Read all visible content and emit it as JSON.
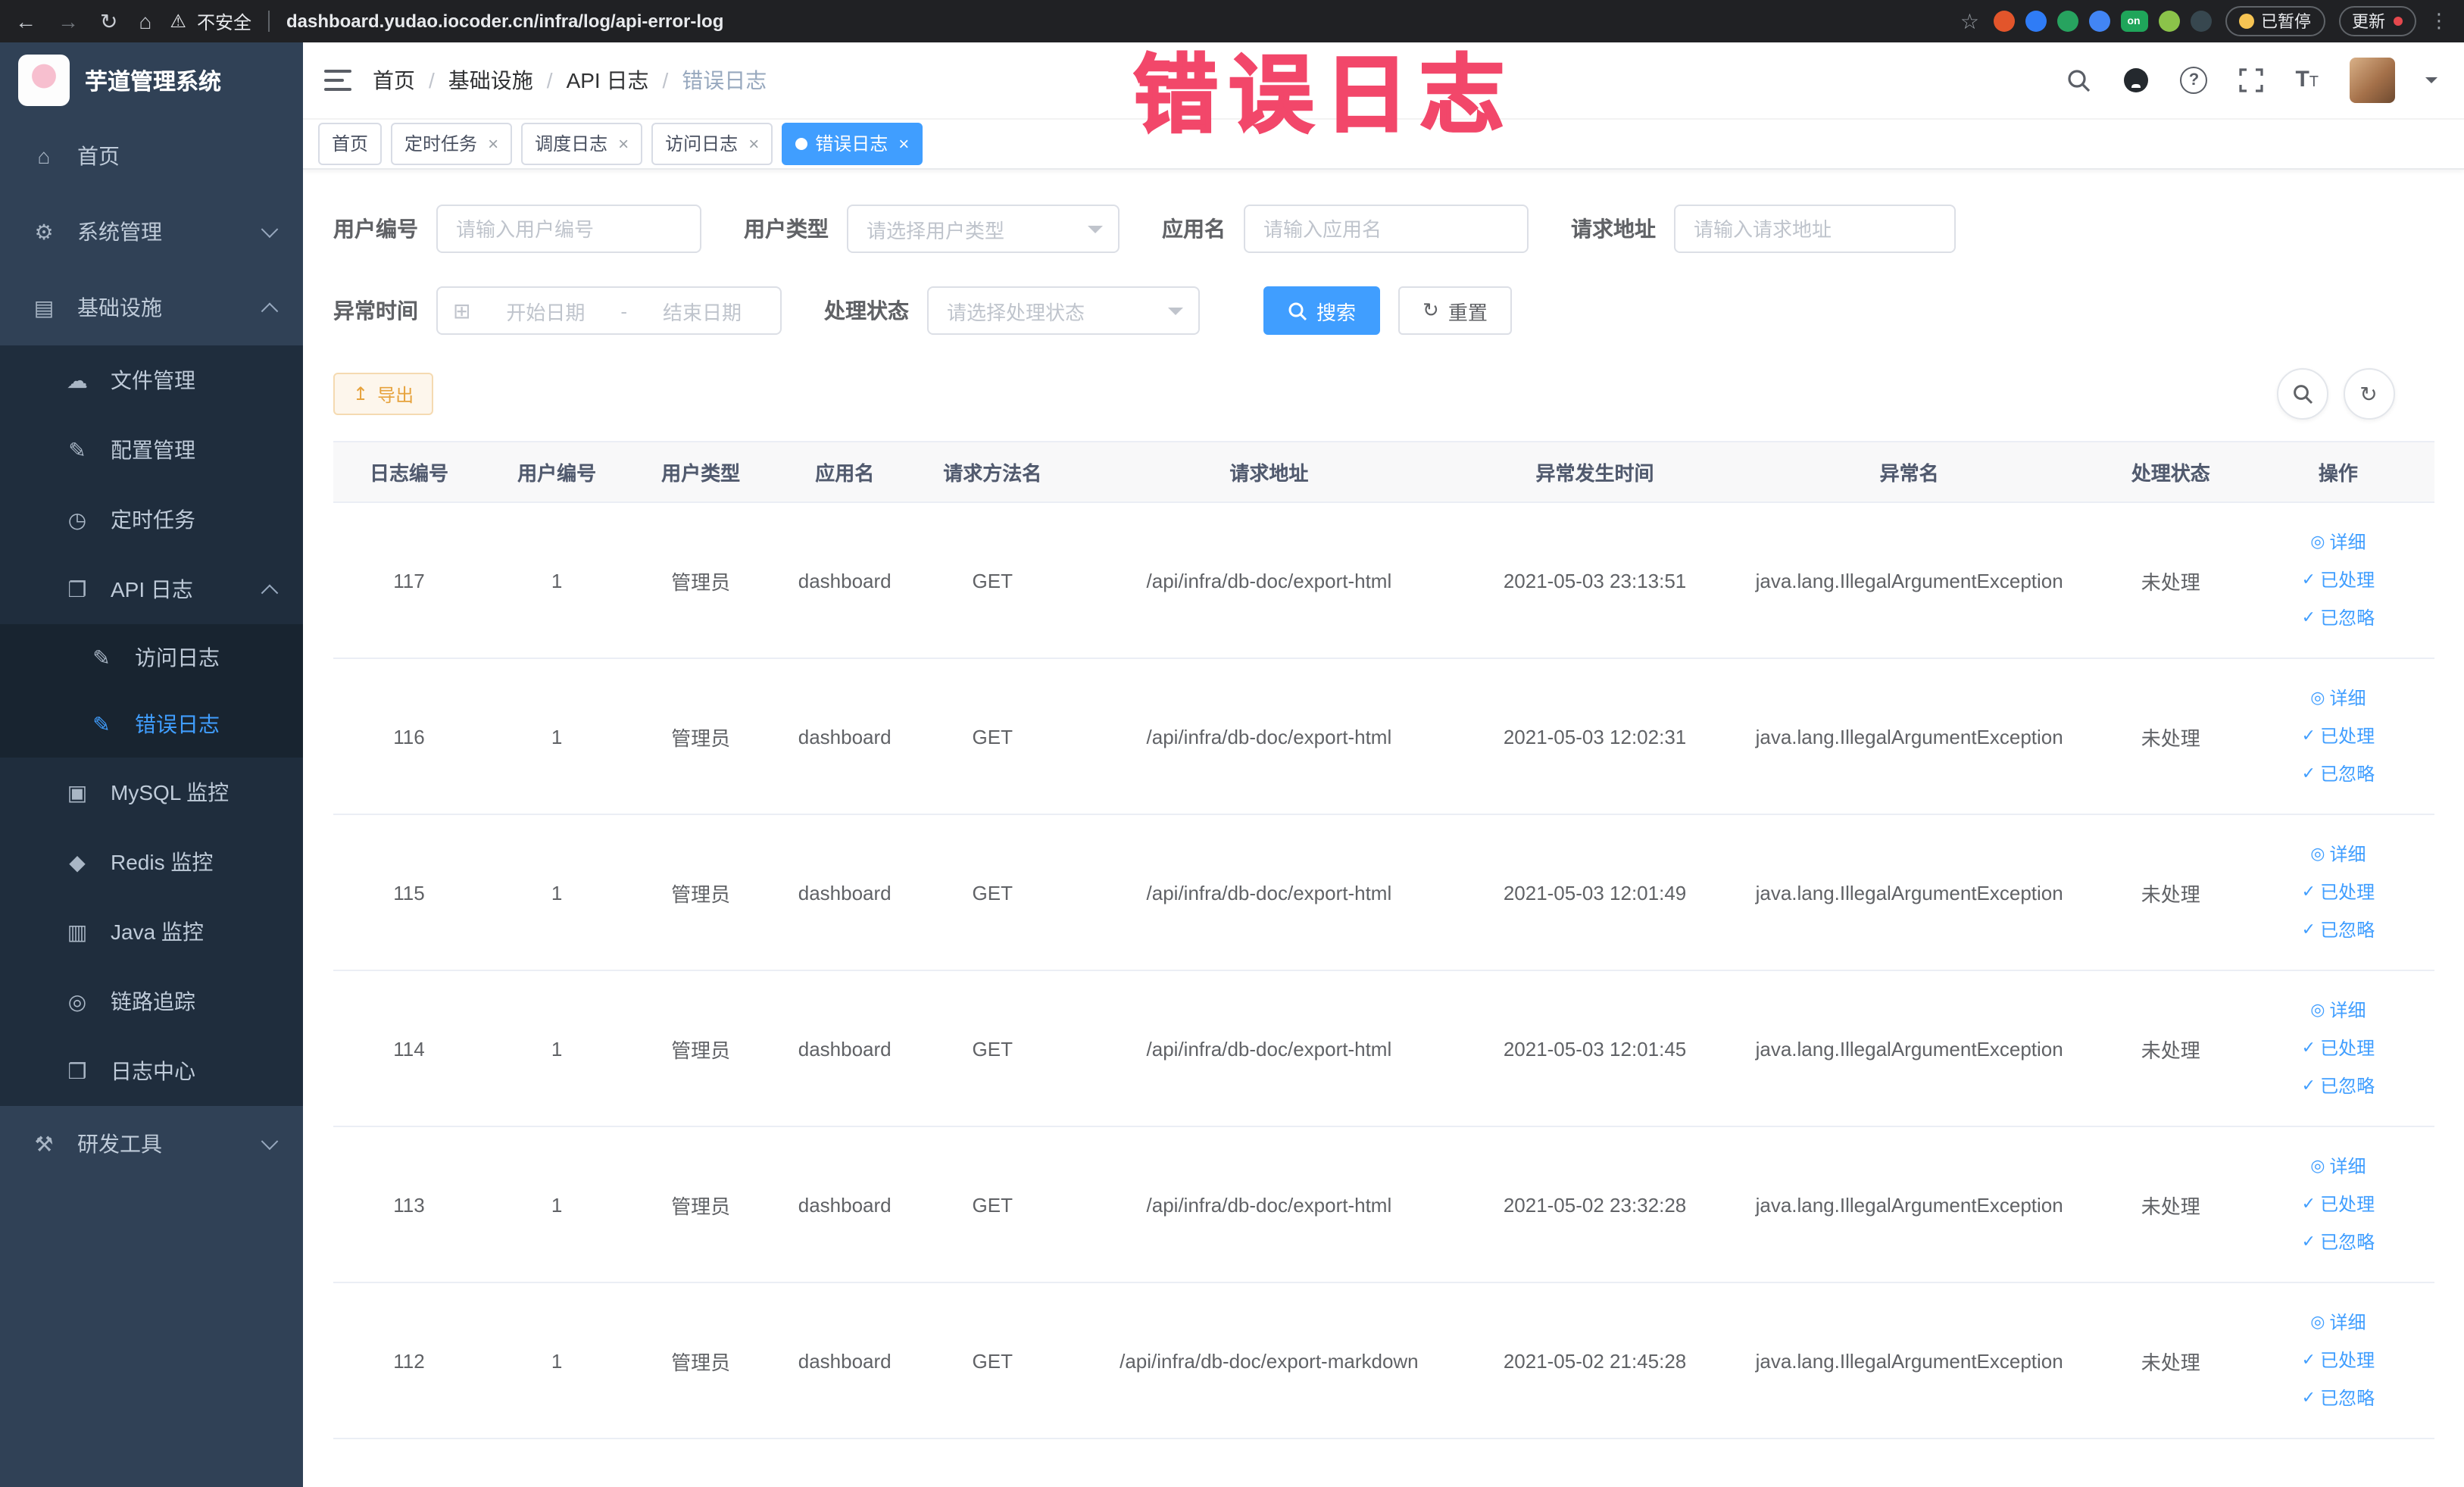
{
  "browser": {
    "security_label": "不安全",
    "url": "dashboard.yudao.iocoder.cn/infra/log/api-error-log",
    "paused_label": "已暂停",
    "update_label": "更新",
    "extensions": [
      {
        "name": "extension-icon-orange",
        "color": "#e2552b",
        "label": ""
      },
      {
        "name": "extension-icon-blue",
        "color": "#2f7cf6",
        "label": ""
      },
      {
        "name": "extension-icon-green",
        "color": "#27a35f",
        "label": ""
      },
      {
        "name": "extension-icon-grid",
        "color": "#4285f4",
        "label": ""
      },
      {
        "name": "extension-icon-switch-on",
        "color": "#1fa55a",
        "label": "on"
      },
      {
        "name": "extension-icon-leaf",
        "color": "#8bc34a",
        "label": ""
      },
      {
        "name": "extension-icon-dark",
        "color": "#37474f",
        "label": ""
      }
    ]
  },
  "icons": {
    "back": "←",
    "forward": "→",
    "reload": "↻",
    "home": "⌂",
    "warning": "⚠",
    "star": "☆",
    "menu_dots": "⋮",
    "close": "×",
    "question": "?",
    "refresh": "↻",
    "grid": "▦",
    "export": "↥",
    "calendar": "⊞",
    "text_big": "T",
    "text_small": "T"
  },
  "annotation": {
    "text": "错误日志",
    "color": "#f2476a"
  },
  "sidebar": {
    "logo_title": "芋道管理系统",
    "items": {
      "home": {
        "label": "首页",
        "icon": "⌂"
      },
      "system": {
        "label": "系统管理",
        "icon": "⚙"
      },
      "infra": {
        "label": "基础设施",
        "icon": "▤"
      },
      "file": {
        "label": "文件管理",
        "icon": "☁"
      },
      "config": {
        "label": "配置管理",
        "icon": "✎"
      },
      "job": {
        "label": "定时任务",
        "icon": "◷"
      },
      "apilog": {
        "label": "API 日志",
        "icon": "❐"
      },
      "accesslog": {
        "label": "访问日志",
        "icon": "✎"
      },
      "errorlog": {
        "label": "错误日志",
        "icon": "✎"
      },
      "mysql": {
        "label": "MySQL 监控",
        "icon": "▣"
      },
      "redis": {
        "label": "Redis 监控",
        "icon": "◆"
      },
      "java": {
        "label": "Java 监控",
        "icon": "▥"
      },
      "trace": {
        "label": "链路追踪",
        "icon": "◎"
      },
      "logcenter": {
        "label": "日志中心",
        "icon": "❒"
      },
      "devtools": {
        "label": "研发工具",
        "icon": "⚒"
      }
    }
  },
  "header": {
    "breadcrumb": [
      "首页",
      "基础设施",
      "API 日志",
      "错误日志"
    ]
  },
  "tabs": [
    {
      "label": "首页"
    },
    {
      "label": "定时任务"
    },
    {
      "label": "调度日志"
    },
    {
      "label": "访问日志"
    },
    {
      "label": "错误日志"
    }
  ],
  "filters": {
    "user_id": {
      "label": "用户编号",
      "placeholder": "请输入用户编号"
    },
    "user_type": {
      "label": "用户类型",
      "placeholder": "请选择用户类型"
    },
    "app_name": {
      "label": "应用名",
      "placeholder": "请输入应用名"
    },
    "request_url": {
      "label": "请求地址",
      "placeholder": "请输入请求地址"
    },
    "exception_time": {
      "label": "异常时间",
      "start_placeholder": "开始日期",
      "separator": "-",
      "end_placeholder": "结束日期"
    },
    "process_status": {
      "label": "处理状态",
      "placeholder": "请选择处理状态"
    },
    "search_button": "搜索",
    "reset_button": "重置"
  },
  "toolbar": {
    "export_button": "导出"
  },
  "table": {
    "columns": [
      "日志编号",
      "用户编号",
      "用户类型",
      "应用名",
      "请求方法名",
      "请求地址",
      "异常发生时间",
      "异常名",
      "处理状态",
      "操作"
    ],
    "rows": [
      {
        "id": "117",
        "user_id": "1",
        "user_type": "管理员",
        "app": "dashboard",
        "method": "GET",
        "url": "/api/infra/db-doc/export-html",
        "time": "2021-05-03 23:13:51",
        "exception": "java.lang.IllegalArgumentException",
        "status": "未处理"
      },
      {
        "id": "116",
        "user_id": "1",
        "user_type": "管理员",
        "app": "dashboard",
        "method": "GET",
        "url": "/api/infra/db-doc/export-html",
        "time": "2021-05-03 12:02:31",
        "exception": "java.lang.IllegalArgumentException",
        "status": "未处理"
      },
      {
        "id": "115",
        "user_id": "1",
        "user_type": "管理员",
        "app": "dashboard",
        "method": "GET",
        "url": "/api/infra/db-doc/export-html",
        "time": "2021-05-03 12:01:49",
        "exception": "java.lang.IllegalArgumentException",
        "status": "未处理"
      },
      {
        "id": "114",
        "user_id": "1",
        "user_type": "管理员",
        "app": "dashboard",
        "method": "GET",
        "url": "/api/infra/db-doc/export-html",
        "time": "2021-05-03 12:01:45",
        "exception": "java.lang.IllegalArgumentException",
        "status": "未处理"
      },
      {
        "id": "113",
        "user_id": "1",
        "user_type": "管理员",
        "app": "dashboard",
        "method": "GET",
        "url": "/api/infra/db-doc/export-html",
        "time": "2021-05-02 23:32:28",
        "exception": "java.lang.IllegalArgumentException",
        "status": "未处理"
      },
      {
        "id": "112",
        "user_id": "1",
        "user_type": "管理员",
        "app": "dashboard",
        "method": "GET",
        "url": "/api/infra/db-doc/export-markdown",
        "time": "2021-05-02 21:45:28",
        "exception": "java.lang.IllegalArgumentException",
        "status": "未处理"
      }
    ],
    "row_actions": [
      {
        "name": "detail-link",
        "icon": "eye-icon",
        "glyph": "◎",
        "label": "详细"
      },
      {
        "name": "mark-processed-link",
        "icon": "check-icon",
        "glyph": "✓",
        "label": "已处理"
      },
      {
        "name": "mark-ignored-link",
        "icon": "check-icon",
        "glyph": "✓",
        "label": "已忽略"
      }
    ]
  },
  "colors": {
    "accent": "#409eff",
    "warning": "#e6a23c",
    "sidebar_bg": "#304156",
    "sidebar_sub_bg": "#1f2d3d",
    "annotation": "#f2476a"
  }
}
